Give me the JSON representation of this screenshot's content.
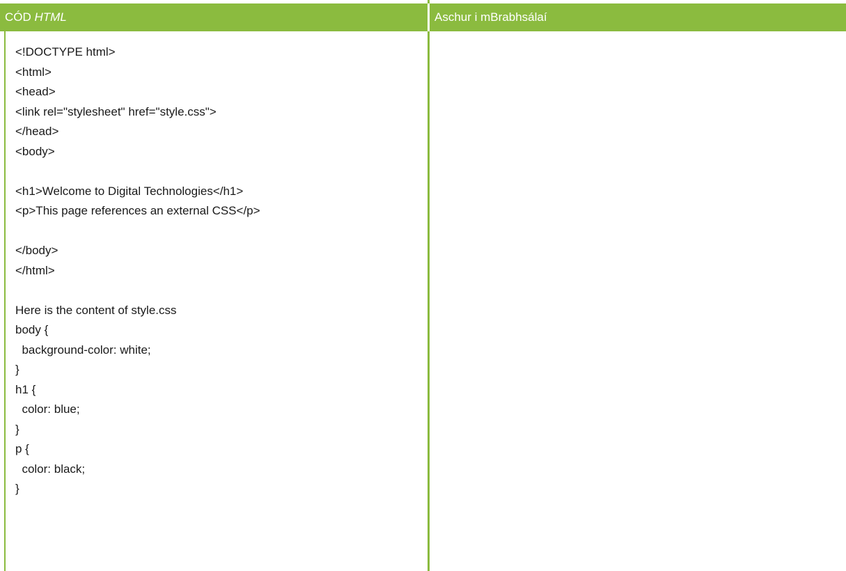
{
  "table": {
    "header": {
      "code_label_plain": "CÓD ",
      "code_label_italic": "HTML",
      "output_label": "Aschur i mBrabhsálaí"
    },
    "code_lines": [
      "<!DOCTYPE html>",
      "<html>",
      "<head>",
      "<link rel=\"stylesheet\" href=\"style.css\">",
      "</head>",
      "<body>",
      "",
      "<h1>Welcome to Digital Technologies</h1>",
      "<p>This page references an external CSS</p>",
      "",
      "</body>",
      "</html>",
      "",
      "Here is the content of style.css",
      "body {",
      "  background-color: white;",
      "}",
      "h1 {",
      "  color: blue;",
      "}",
      "p {",
      "  color: black;",
      "}"
    ],
    "output": ""
  },
  "colors": {
    "accent_green": "#8bbb3f",
    "header_text": "#ffffff",
    "body_text": "#1a1a1a"
  }
}
